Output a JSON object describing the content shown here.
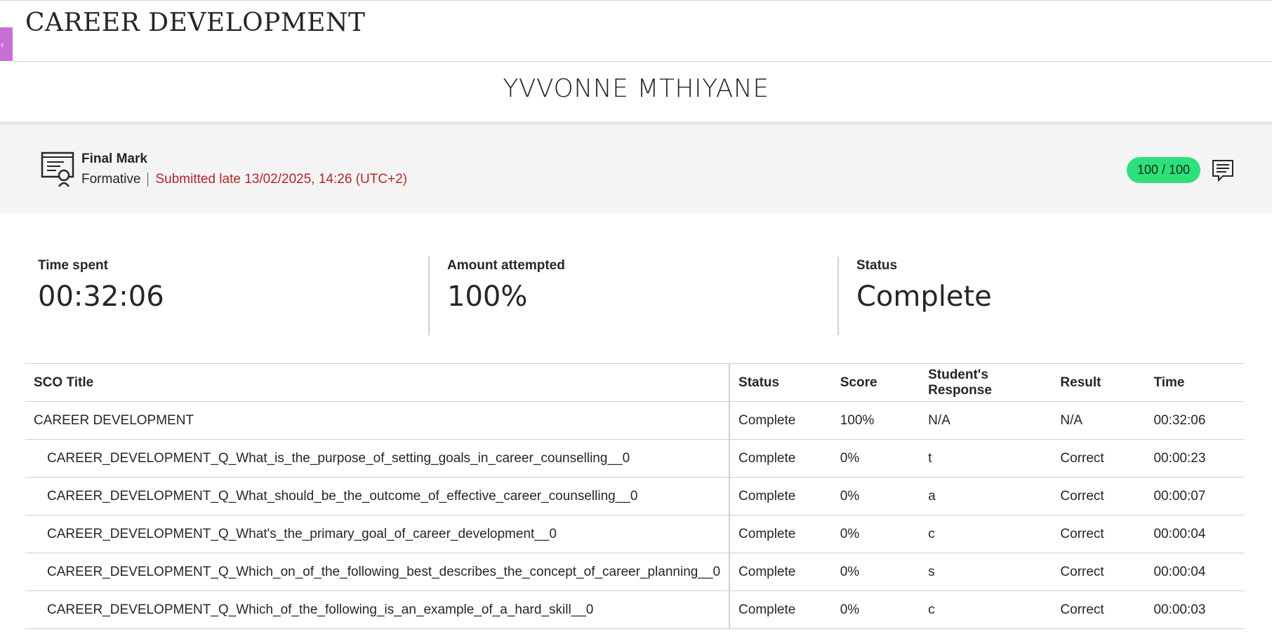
{
  "page": {
    "title": "CAREER DEVELOPMENT",
    "student_name": "YVVONNE MTHIYANE"
  },
  "grade": {
    "title": "Final Mark",
    "type": "Formative",
    "submission": "Submitted late 13/02/2025, 14:26 (UTC+2)",
    "score": "100 / 100",
    "colors": {
      "pill": "#2ee07a",
      "late": "#b3262b"
    }
  },
  "stats": [
    {
      "label": "Time spent",
      "value": "00:32:06"
    },
    {
      "label": "Amount attempted",
      "value": "100%"
    },
    {
      "label": "Status",
      "value": "Complete"
    }
  ],
  "table": {
    "headers": [
      "SCO Title",
      "Status",
      "Score",
      "Student's Response",
      "Result",
      "Time"
    ],
    "rows": [
      {
        "title": "CAREER DEVELOPMENT",
        "status": "Complete",
        "score": "100%",
        "response": "N/A",
        "result": "N/A",
        "time": "00:32:06"
      },
      {
        "title": "CAREER_DEVELOPMENT_Q_What_is_the_purpose_of_setting_goals_in_career_counselling__0",
        "status": "Complete",
        "score": "0%",
        "response": "t",
        "result": "Correct",
        "time": "00:00:23"
      },
      {
        "title": "CAREER_DEVELOPMENT_Q_What_should_be_the_outcome_of_effective_career_counselling__0",
        "status": "Complete",
        "score": "0%",
        "response": "a",
        "result": "Correct",
        "time": "00:00:07"
      },
      {
        "title": "CAREER_DEVELOPMENT_Q_What's_the_primary_goal_of_career_development__0",
        "status": "Complete",
        "score": "0%",
        "response": "c",
        "result": "Correct",
        "time": "00:00:04"
      },
      {
        "title": "CAREER_DEVELOPMENT_Q_Which_on_of_the_following_best_describes_the_concept_of_career_planning__0",
        "status": "Complete",
        "score": "0%",
        "response": "s",
        "result": "Correct",
        "time": "00:00:04"
      },
      {
        "title": "CAREER_DEVELOPMENT_Q_Which_of_the_following_is_an_example_of_a_hard_skill__0",
        "status": "Complete",
        "score": "0%",
        "response": "c",
        "result": "Correct",
        "time": "00:00:03"
      }
    ]
  },
  "icons": {
    "side_tab": "chevron-left-icon",
    "certificate": "certificate-icon",
    "feedback": "comment-icon"
  }
}
